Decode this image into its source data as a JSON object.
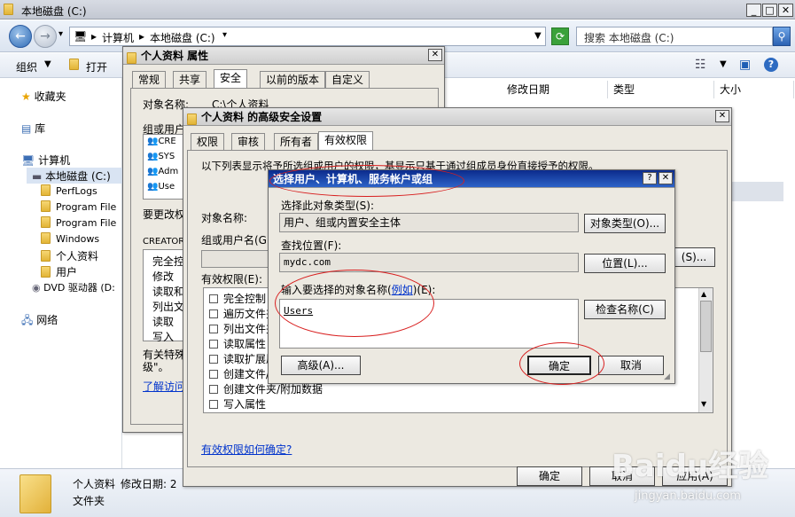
{
  "explorer": {
    "window_title": "本地磁盘 (C:)",
    "address": [
      "计算机",
      "本地磁盘 (C:)"
    ],
    "search_placeholder": "搜索 本地磁盘 (C:)",
    "cmd": {
      "organize": "组织",
      "open": "打开"
    },
    "columns": [
      "修改日期",
      "类型",
      "大小"
    ],
    "tree": [
      {
        "label": "收藏夹",
        "icon": "star-icon"
      },
      {
        "label": "库",
        "icon": "library-icon"
      },
      {
        "label": "计算机",
        "icon": "computer-icon"
      },
      {
        "label": "本地磁盘 (C:)",
        "icon": "drive-icon",
        "selected": true
      },
      {
        "label": "PerfLogs",
        "icon": "folder-icon"
      },
      {
        "label": "Program File",
        "icon": "folder-icon"
      },
      {
        "label": "Program File",
        "icon": "folder-icon"
      },
      {
        "label": "Windows",
        "icon": "folder-icon"
      },
      {
        "label": "个人资料",
        "icon": "folder-icon"
      },
      {
        "label": "用户",
        "icon": "folder-icon"
      },
      {
        "label": "DVD 驱动器 (D:",
        "icon": "dvd-icon"
      },
      {
        "label": "网络",
        "icon": "network-icon"
      }
    ],
    "details": {
      "name": "个人资料",
      "modified_label": "修改日期: 2",
      "type": "文件夹"
    }
  },
  "props_dialog": {
    "title": "个人资料 属性",
    "tabs": [
      "常规",
      "共享",
      "安全",
      "以前的版本",
      "自定义"
    ],
    "object_name_label": "对象名称:",
    "object_name_value": "C:\\个人资料",
    "group_label": "组或用户名",
    "users": [
      "CRE",
      "SYS",
      "Adm",
      "Use"
    ],
    "change_perm": "要更改权",
    "creator": "CREATOR",
    "perms": [
      "完全控",
      "修改",
      "读取和",
      "列出文",
      "读取",
      "写入"
    ],
    "special": "有关特殊",
    "special2": "级\"。",
    "learn_link": "了解访问"
  },
  "adv_dialog": {
    "title": "个人资料 的高级安全设置",
    "tabs": [
      "权限",
      "审核",
      "所有者",
      "有效权限"
    ],
    "desc": "以下列表显示将予所选组或用户的权限，基显示只基于通过组成员身份直接授予的权限。",
    "object_name_label": "对象名称:",
    "group_label": "组或用户名(G",
    "select_btn_tail": "(S)...",
    "effective_label": "有效权限(E):",
    "perm_items": [
      "完全控制",
      "遍历文件夹",
      "列出文件夹",
      "读取属性",
      "读取扩展属",
      "创建文件/",
      "创建文件夹/附加数据",
      "写入属性"
    ],
    "howto_link": "有效权限如何确定?",
    "ok": "确定",
    "cancel": "取消",
    "apply": "应用(A)"
  },
  "select_dialog": {
    "title": "选择用户、计算机、服务帐户或组",
    "help": "?",
    "type_label": "选择此对象类型(S):",
    "type_value": "用户、组或内置安全主体",
    "type_btn": "对象类型(O)...",
    "loc_label": "查找位置(F):",
    "loc_value": "mydc.com",
    "loc_btn": "位置(L)...",
    "name_label_pre": "输入要选择的对象名称(",
    "name_label_link": "例如",
    "name_label_post": ")(E):",
    "name_value": "Users",
    "check_btn": "检查名称(C)",
    "advanced_btn": "高级(A)...",
    "ok": "确定",
    "cancel": "取消"
  },
  "watermark": {
    "brand": "Baidu经验",
    "url": "jingyan.baidu.com"
  }
}
